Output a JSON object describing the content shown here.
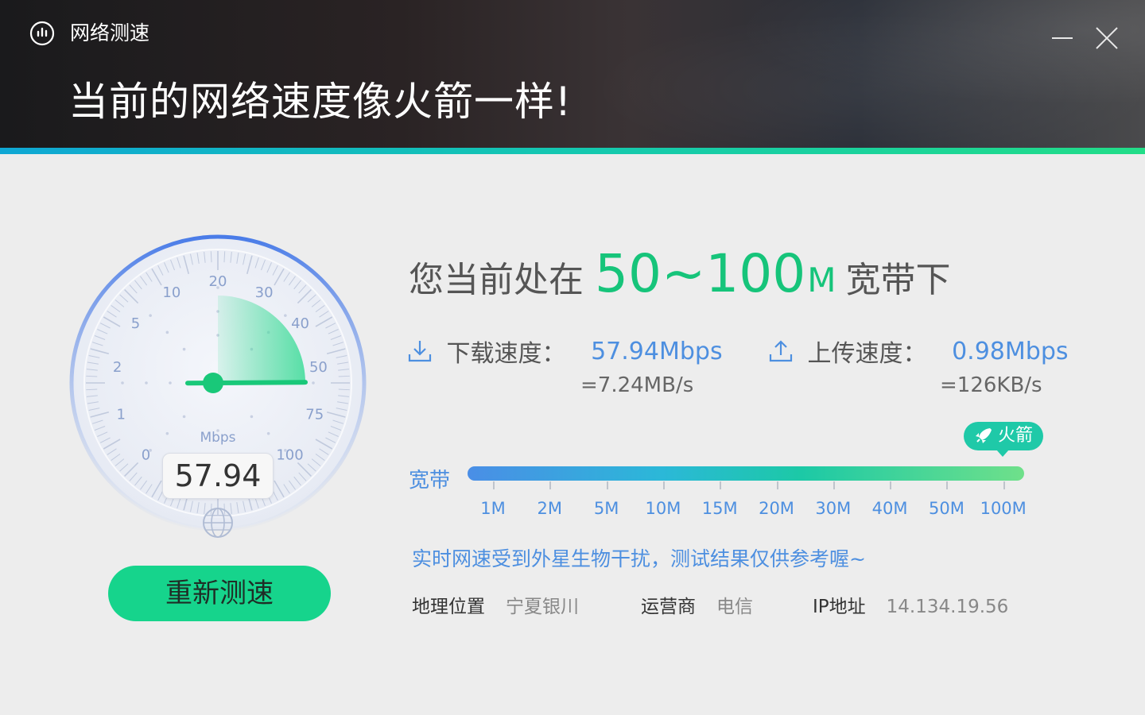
{
  "window": {
    "title": "网络测速",
    "banner": "当前的网络速度像火箭一样!"
  },
  "gauge": {
    "value": 57.94,
    "value_text": "57.94",
    "unit_label": "Mbps",
    "ticks": [
      "0",
      "1",
      "2",
      "5",
      "10",
      "20",
      "30",
      "40",
      "50",
      "75",
      "100"
    ],
    "colors": {
      "ring": "#4a7ce8",
      "fill": "#3ddc98",
      "needle": "#19c879"
    }
  },
  "retest_button": "重新测速",
  "headline": {
    "prefix": "您当前处在",
    "range": "50~100",
    "unit": "M",
    "suffix": "宽带下"
  },
  "download": {
    "label": "下载速度：",
    "value": "57.94Mbps",
    "sub": "=7.24MB/s",
    "icon": "download-icon"
  },
  "upload": {
    "label": "上传速度：",
    "value": "0.98Mbps",
    "sub": "=126KB/s",
    "icon": "upload-icon"
  },
  "bandwidth": {
    "label": "宽带",
    "badge": "火箭",
    "badge_icon": "rocket-icon",
    "ticks": [
      "1M",
      "2M",
      "5M",
      "10M",
      "15M",
      "20M",
      "30M",
      "40M",
      "50M",
      "100M"
    ],
    "current_level": "100M"
  },
  "notice": "实时网速受到外星生物干扰，测试结果仅供参考喔~",
  "info": {
    "location_label": "地理位置",
    "location": "宁夏银川",
    "isp_label": "运营商",
    "isp": "电信",
    "ip_label": "IP地址",
    "ip": "14.134.19.56"
  },
  "colors": {
    "accent_green": "#16c47a",
    "accent_blue": "#4d8fe0",
    "button_green": "#16d48c"
  }
}
